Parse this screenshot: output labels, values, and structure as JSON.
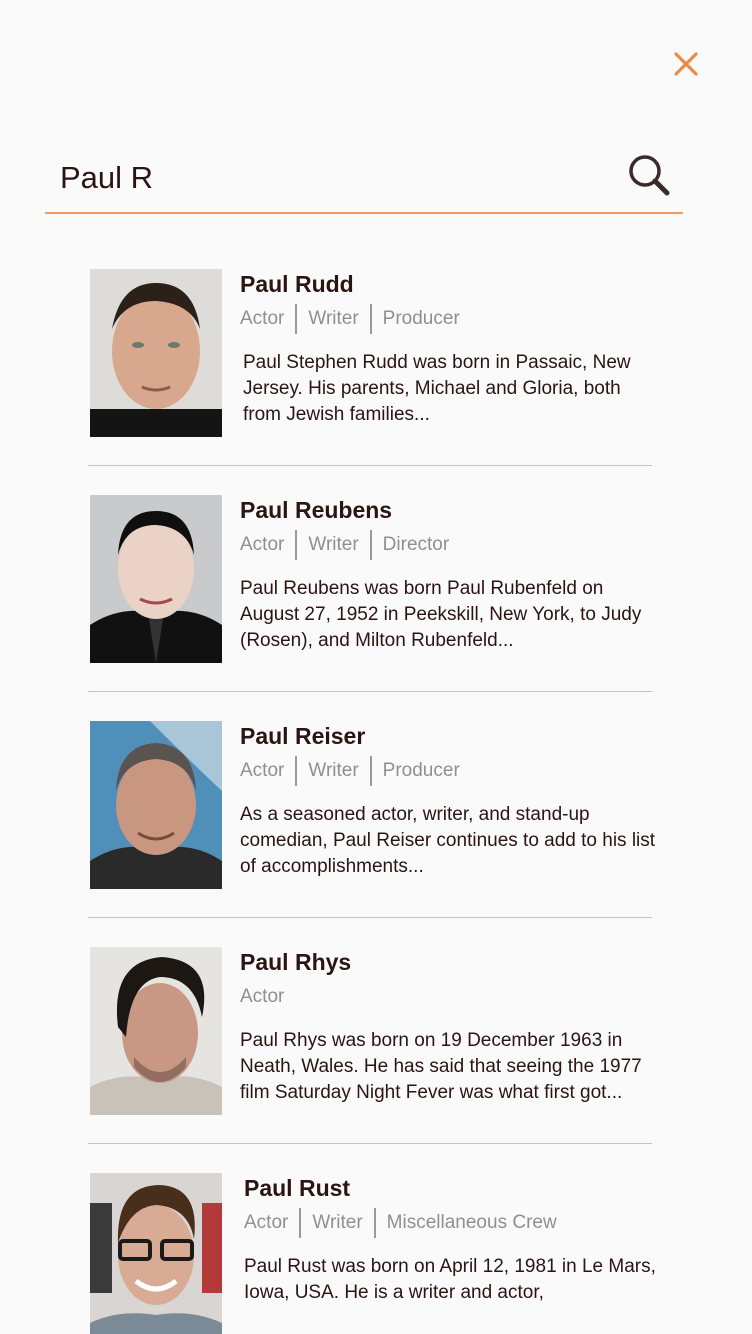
{
  "search": {
    "query": "Paul R",
    "close_icon": "close-icon",
    "search_icon": "search-icon"
  },
  "colors": {
    "accent": "#ee8a43",
    "divider": "#f0b88c",
    "text_primary": "#2a1512",
    "text_muted": "#8f8f8f",
    "background": "#fafafa"
  },
  "results": [
    {
      "name": "Paul Rudd",
      "roles": [
        "Actor",
        "Writer",
        "Producer"
      ],
      "bio": "Paul Stephen Rudd was born in Passaic, New Jersey. His parents, Michael and Gloria, both from Jewish families..."
    },
    {
      "name": "Paul Reubens",
      "roles": [
        "Actor",
        "Writer",
        "Director"
      ],
      "bio": "Paul Reubens was born Paul Rubenfeld on August 27, 1952 in Peekskill, New York, to Judy (Rosen), and Milton Rubenfeld..."
    },
    {
      "name": "Paul Reiser",
      "roles": [
        "Actor",
        "Writer",
        "Producer"
      ],
      "bio": "As a seasoned actor, writer, and stand-up comedian, Paul Reiser continues to add to his list of accomplishments..."
    },
    {
      "name": "Paul Rhys",
      "roles": [
        "Actor"
      ],
      "bio": "Paul Rhys was born on 19 December 1963 in Neath, Wales. He has said that seeing the 1977 film Saturday Night Fever was what first got..."
    },
    {
      "name": "Paul Rust",
      "roles": [
        "Actor",
        "Writer",
        "Miscellaneous Crew"
      ],
      "bio": "Paul Rust was born on April 12, 1981 in Le Mars, Iowa, USA. He is a writer and actor,"
    }
  ]
}
